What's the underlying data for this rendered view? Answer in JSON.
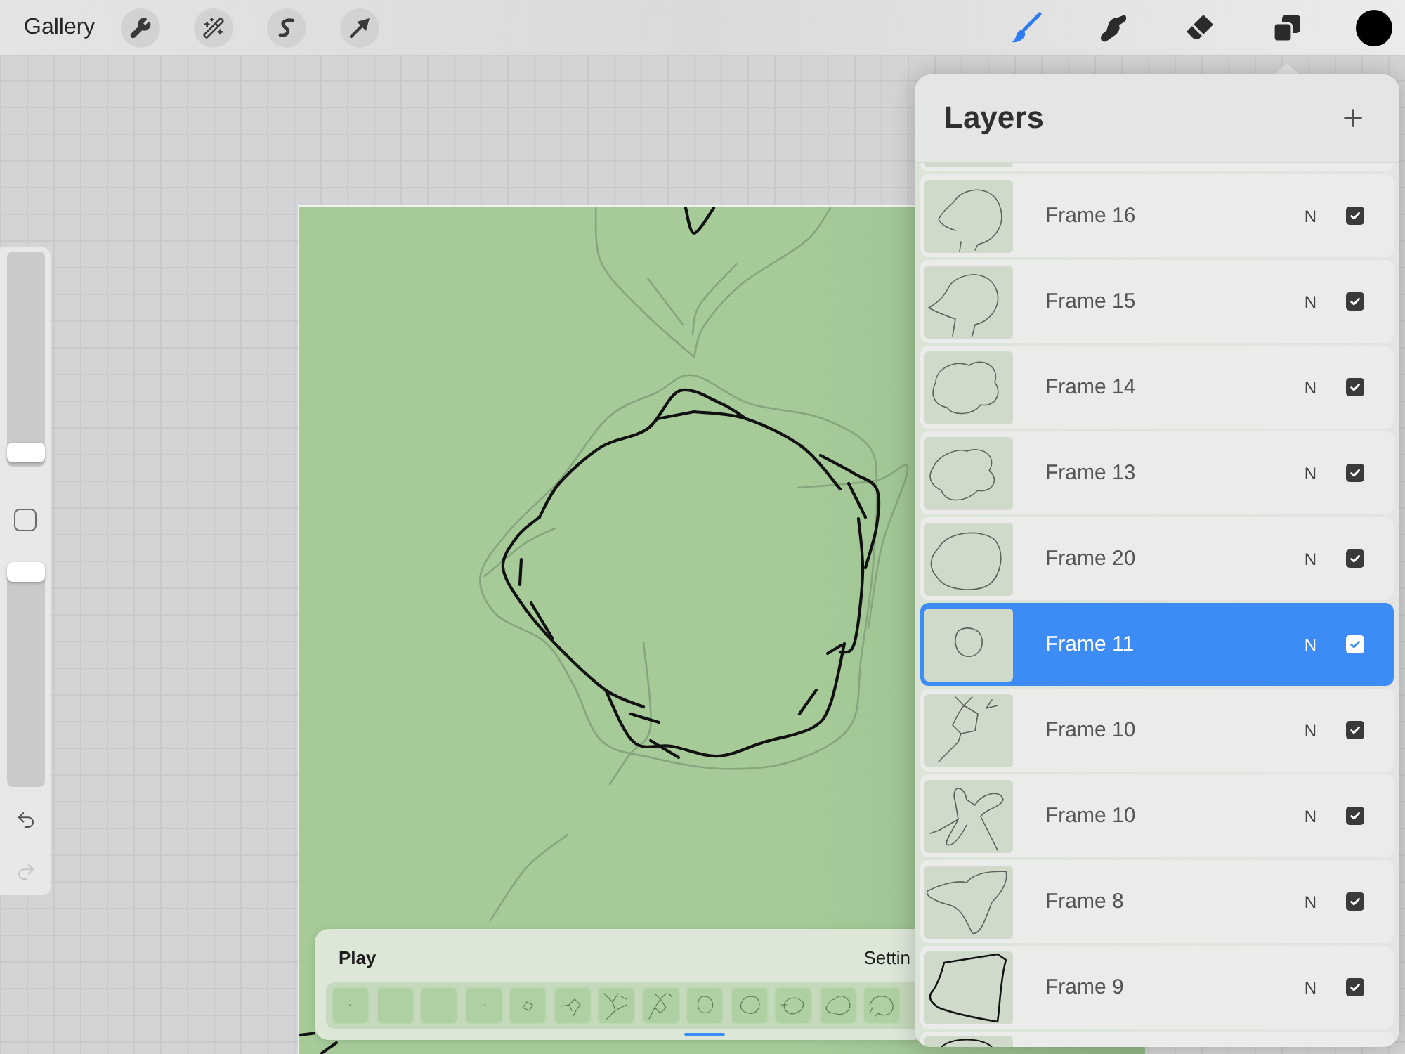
{
  "top_bar": {
    "gallery": "Gallery",
    "left_tools": [
      {
        "kind": "wrench"
      },
      {
        "kind": "wand"
      },
      {
        "kind": "selection"
      },
      {
        "kind": "transform"
      }
    ],
    "right_tools": [
      {
        "kind": "brush",
        "selected": true
      },
      {
        "kind": "smudge",
        "selected": false
      },
      {
        "kind": "eraser",
        "selected": false
      },
      {
        "kind": "layers",
        "selected": false
      }
    ]
  },
  "sidebar": {
    "sliders": [
      {
        "level": 0.02
      },
      {
        "level": 1
      }
    ],
    "undo": {
      "disabled": false
    },
    "redo": {
      "disabled": true
    }
  },
  "layers": {
    "title": "Layers",
    "rows": [
      {
        "name": "Frame 16",
        "blend": "N",
        "visible": true,
        "selected": false
      },
      {
        "name": "Frame 15",
        "blend": "N",
        "visible": true,
        "selected": false
      },
      {
        "name": "Frame 14",
        "blend": "N",
        "visible": true,
        "selected": false
      },
      {
        "name": "Frame 13",
        "blend": "N",
        "visible": true,
        "selected": false
      },
      {
        "name": "Frame 20",
        "blend": "N",
        "visible": true,
        "selected": false
      },
      {
        "name": "Frame 11",
        "blend": "N",
        "visible": true,
        "selected": true
      },
      {
        "name": "Frame 10",
        "blend": "N",
        "visible": true,
        "selected": false
      },
      {
        "name": "Frame 10",
        "blend": "N",
        "visible": true,
        "selected": false
      },
      {
        "name": "Frame 8",
        "blend": "N",
        "visible": true,
        "selected": false
      },
      {
        "name": "Frame 9",
        "blend": "N",
        "visible": true,
        "selected": false
      }
    ]
  },
  "timeline": {
    "play": "Play",
    "settings": "Settin",
    "frames": [
      {
        "selected": false
      },
      {
        "selected": false
      },
      {
        "selected": false
      },
      {
        "selected": false
      },
      {
        "selected": false
      },
      {
        "selected": false
      },
      {
        "selected": false
      },
      {
        "selected": false
      },
      {
        "selected": true
      },
      {
        "selected": false
      },
      {
        "selected": false
      },
      {
        "selected": false
      },
      {
        "selected": false
      }
    ]
  }
}
